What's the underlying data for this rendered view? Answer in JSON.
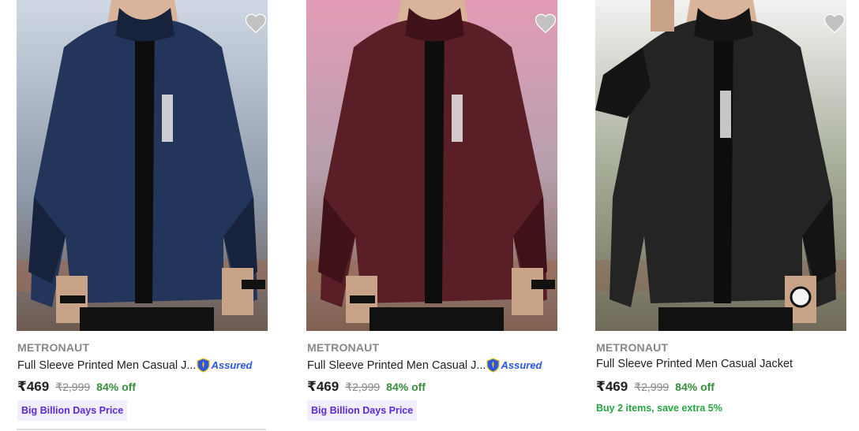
{
  "products": [
    {
      "brand": "METRONAUT",
      "title": "Full Sleeve Printed Men Casual J...",
      "assured": "Assured",
      "price": "₹469",
      "mrp": "₹2,999",
      "discount": "84% off",
      "badge": "Big Billion Days Price",
      "jacket_color": "#24355c",
      "jacket_dark": "#17223d",
      "bg_color": "#7a8aa0"
    },
    {
      "brand": "METRONAUT",
      "title": "Full Sleeve Printed Men Casual J...",
      "assured": "Assured",
      "price": "₹469",
      "mrp": "₹2,999",
      "discount": "84% off",
      "badge": "Big Billion Days Price",
      "jacket_color": "#5a1e26",
      "jacket_dark": "#3e1218",
      "bg_color": "#b58aa2"
    },
    {
      "brand": "METRONAUT",
      "title": "Full Sleeve Printed Men Casual Jacket",
      "price": "₹469",
      "mrp": "₹2,999",
      "discount": "84% off",
      "offer": "Buy 2 items, save extra 5%",
      "jacket_color": "#242424",
      "jacket_dark": "#141414",
      "bg_color": "#8f9a88"
    }
  ],
  "colors": {
    "discount_green": "#388e3c",
    "offer_green": "#26a541",
    "badge_purple": "#5b2ad6",
    "assured_blue": "#2a55e5"
  },
  "icons": [
    "heart-icon",
    "assured-shield-icon"
  ]
}
